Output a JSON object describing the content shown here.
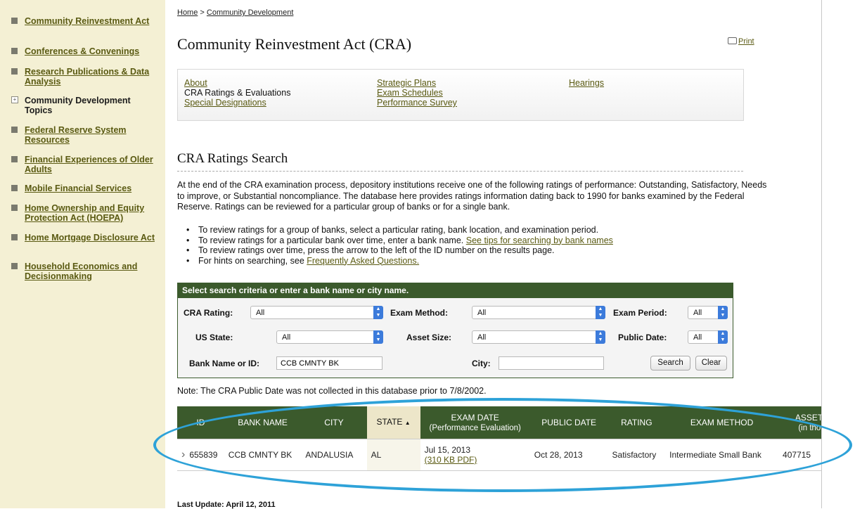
{
  "sidebar": {
    "items": [
      {
        "label": "Community Reinvestment Act"
      },
      {
        "label": "Conferences & Convenings"
      },
      {
        "label": "Research Publications & Data Analysis"
      },
      {
        "label": "Community Development Topics"
      },
      {
        "label": "Federal Reserve System Resources"
      },
      {
        "label": "Financial Experiences of Older Adults"
      },
      {
        "label": "Mobile Financial Services"
      },
      {
        "label": "Home Ownership and Equity Protection Act (HOEPA)"
      },
      {
        "label": "Home Mortgage Disclosure Act"
      },
      {
        "label": "Household Economics and Decisionmaking"
      }
    ]
  },
  "breadcrumb": {
    "home": "Home",
    "separator": " > ",
    "current": "Community Development"
  },
  "page": {
    "title": "Community Reinvestment Act (CRA)",
    "print_label": "Print"
  },
  "subnav": {
    "about": "About",
    "ratings": "CRA Ratings & Evaluations",
    "special": "Special Designations",
    "strategic": "Strategic Plans",
    "schedules": "Exam Schedules",
    "survey": "Performance Survey",
    "hearings": "Hearings"
  },
  "section": {
    "title": "CRA Ratings Search",
    "intro": "At the end of the CRA examination process, depository institutions receive one of the following ratings of performance: Outstanding, Satisfactory, Needs to improve, or Substantial noncompliance. The database here provides ratings information dating back to 1990 for banks examined by the Federal Reserve. Ratings can be reviewed for a particular group of banks or for a single bank.",
    "bullets": {
      "b1": "To review ratings for a group of banks, select a particular rating, bank location, and examination period.",
      "b2_text": "To review ratings for a particular bank over time, enter a bank name. ",
      "b2_link": "See tips for searching by bank names",
      "b3": "To review ratings over time, press the arrow to the left of the ID number on the results page.",
      "b4_text": "For hints on searching, see ",
      "b4_link": "Frequently Asked Questions."
    }
  },
  "search": {
    "header": "Select search criteria or enter a bank name or city name.",
    "cra_rating_label": "CRA Rating:",
    "cra_rating_value": "All",
    "exam_method_label": "Exam Method:",
    "exam_method_value": "All",
    "exam_period_label": "Exam Period:",
    "exam_period_value": "All",
    "us_state_label": "US State:",
    "us_state_value": "All",
    "asset_size_label": "Asset Size:",
    "asset_size_value": "All",
    "public_date_label": "Public Date:",
    "public_date_value": "All",
    "bank_name_label": "Bank Name or ID:",
    "bank_name_value": "CCB CMNTY BK",
    "city_label": "City:",
    "city_value": "",
    "search_button": "Search",
    "clear_button": "Clear"
  },
  "note": "Note: The CRA Public Date was not collected in this database prior to 7/8/2002.",
  "results": {
    "headers": {
      "id": "ID",
      "bank_name": "BANK NAME",
      "city": "CITY",
      "state": "STATE",
      "sort_arrow": "▲",
      "exam_date": "EXAM DATE",
      "exam_date_sub": "(Performance Evaluation)",
      "public_date": "PUBLIC DATE",
      "rating": "RATING",
      "exam_method": "EXAM METHOD",
      "assets": "ASSETS",
      "assets_sub": "(in thou"
    },
    "rows": [
      {
        "expand": "›",
        "id": "655839",
        "bank_name": "CCB CMNTY BK",
        "city": "ANDALUSIA",
        "state": "AL",
        "exam_date": "Jul 15, 2013",
        "pdf_link": "(310 KB PDF)",
        "public_date": "Oct 28, 2013",
        "rating": "Satisfactory",
        "exam_method": "Intermediate Small Bank",
        "assets": "407715"
      }
    ]
  },
  "last_update": "Last Update: April 12, 2011",
  "colors": {
    "header_green": "#3b5a2c",
    "sidebar_bg": "#f4f0d4",
    "link_olive": "#5a5a12",
    "highlight_blue": "#2ea2d8"
  }
}
